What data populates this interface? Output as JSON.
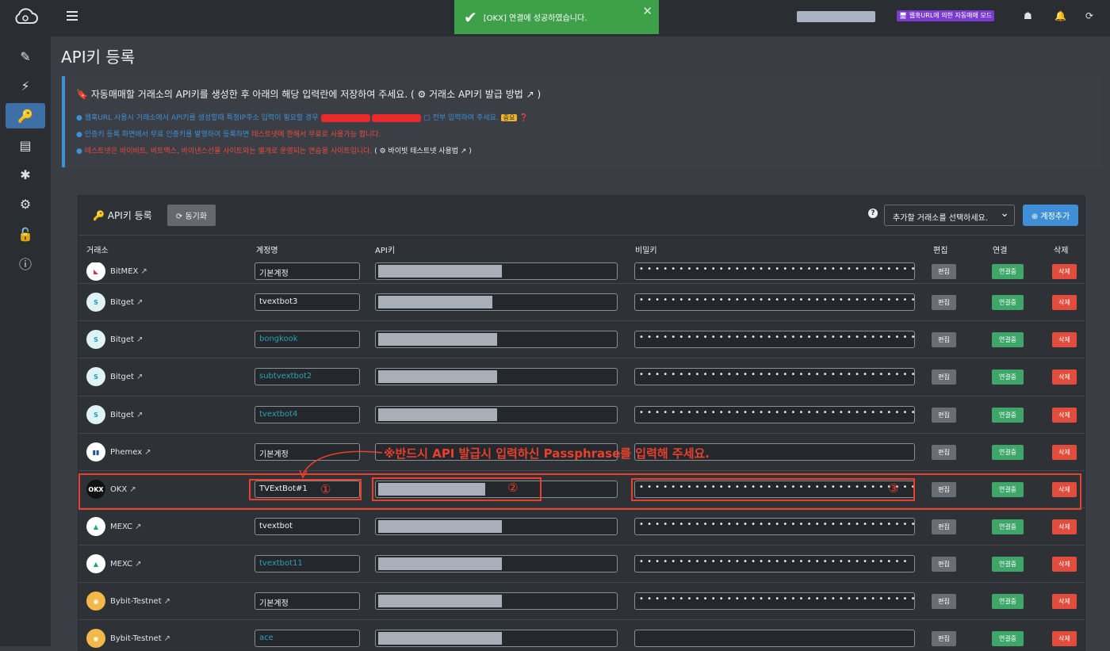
{
  "toast": {
    "message": "[OKX] 연결에 성공하였습니다.",
    "check": "✔",
    "close": "✕"
  },
  "topbar": {
    "mode_badge": "🖥 웹훅URL에 의한 자동매매 모드"
  },
  "page": {
    "title": "API키 등록"
  },
  "info": {
    "heading": "자동매매할 거래소의 API키를 생성한 후 아래의 해당 입력란에 저장하여 주세요. ( ⚙ 거래소 API키 발급 방법 ↗ )",
    "line1_a": "● 웹훅URL 사용시 거래소에서 API키를 생성할때 특정IP주소 입력이 필요할 경우",
    "line1_b": "▢ 전부 입력하여 주세요.",
    "line1_badge": "중요",
    "line2_a": "● 인증키 등록 화면에서 무료 인증키를 발행하여 등록하면 ",
    "line2_b": "테스트넷에 한해서 무료로 사용가능 합니다.",
    "line3_a": "● ",
    "line3_b": "테스트넷은 바이비트, 비트멕스, 바이낸스선물 사이트와는 별개로 운영되는 연습용 사이트입니다.",
    "line3_c": " ( ⚙ 바이빗 테스트넷 사용법 ↗ )"
  },
  "card": {
    "title": "🔑 API키 등록",
    "sync": "⟳ 동기화",
    "select": "추가할 거래소를 선택하세요.",
    "add": "⊕ 계정추가",
    "help": "?"
  },
  "columns": {
    "exchange": "거래소",
    "account": "계정명",
    "api_key": "API키",
    "secret": "비밀키",
    "edit": "편집",
    "connect": "연결",
    "delete": "삭제"
  },
  "buttons": {
    "edit": "편집",
    "connected": "연결중",
    "delete": "삭제"
  },
  "annotation": "※반드시 API 발급시 입력하신 Passphrase를 입력해 주세요.",
  "circled": [
    "①",
    "②",
    "③"
  ],
  "rows": [
    {
      "exchange": "BitMEX",
      "account": "기본계정",
      "account_color": "white",
      "logo_bg": "#ffffff",
      "logo_fg": "#c23a5a",
      "api_mask": 0.52,
      "dots": "• • • • • • • • • • • • • • • • • • • • • • • • • • • • • • • • • • • •"
    },
    {
      "exchange": "Bitget",
      "account": "tvextbot3",
      "account_color": "white",
      "logo_bg": "#dff3f6",
      "logo_fg": "#1a9bb0",
      "api_mask": 0.48,
      "dots": "• • • • • • • • • • • • • • • • • • • • • • • • • • • • • • • • • • • •"
    },
    {
      "exchange": "Bitget",
      "account": "bongkook",
      "account_color": "teal",
      "logo_bg": "#dff3f6",
      "logo_fg": "#1a9bb0",
      "api_mask": 0.5,
      "dots": "• • • • • • • • • • • • • • • • • • • • • • • • • • • • • • • • • • • •"
    },
    {
      "exchange": "Bitget",
      "account": "subtvextbot2",
      "account_color": "teal",
      "logo_bg": "#dff3f6",
      "logo_fg": "#1a9bb0",
      "api_mask": 0.5,
      "dots": "• • • • • • • • • • • • • • • • • • • • • • • • • • • • • • • • • • • •"
    },
    {
      "exchange": "Bitget",
      "account": "tvextbot4",
      "account_color": "teal",
      "logo_bg": "#dff3f6",
      "logo_fg": "#1a9bb0",
      "api_mask": 0.5,
      "dots": "• • • • • • • • • • • • • • • • • • • • • • • • • • • • • • • • • • • •"
    },
    {
      "exchange": "Phemex",
      "account": "기본계정",
      "account_color": "white",
      "logo_bg": "#ffffff",
      "logo_fg": "#1b4fa0",
      "api_mask": 0,
      "dots": ""
    },
    {
      "exchange": "OKX",
      "account": "TVExtBot#1",
      "account_color": "white",
      "logo_bg": "#111111",
      "logo_fg": "#ffffff",
      "api_mask": 0.45,
      "dots": "• • • • • • • • • • • • • • • • • • • • • • • • • • • • • • • • • • •"
    },
    {
      "exchange": "MEXC",
      "account": "tvextbot",
      "account_color": "white",
      "logo_bg": "#ffffff",
      "logo_fg": "#18a86a",
      "api_mask": 0.52,
      "dots": "• • • • • • • • • • • • • • • • • • • • • • • • • • • • • • • • • • •"
    },
    {
      "exchange": "MEXC",
      "account": "tvextbot11",
      "account_color": "teal",
      "logo_bg": "#ffffff",
      "logo_fg": "#18a86a",
      "api_mask": 0.52,
      "dots": "• • • • • • • • • • • • • • • • • • • • • • • • • • • • • • • • • •"
    },
    {
      "exchange": "Bybit-Testnet",
      "account": "기본계정",
      "account_color": "white",
      "logo_bg": "#f3b84a",
      "logo_fg": "#ffffff",
      "api_mask": 0.52,
      "dots": "• • • • • • • • • • • • • • • • • • • • • • • • • • • • • • • • • • • •"
    },
    {
      "exchange": "Bybit-Testnet",
      "account": "ace",
      "account_color": "teal",
      "logo_bg": "#f3b84a",
      "logo_fg": "#ffffff",
      "api_mask": 0.52,
      "dots": ""
    }
  ]
}
